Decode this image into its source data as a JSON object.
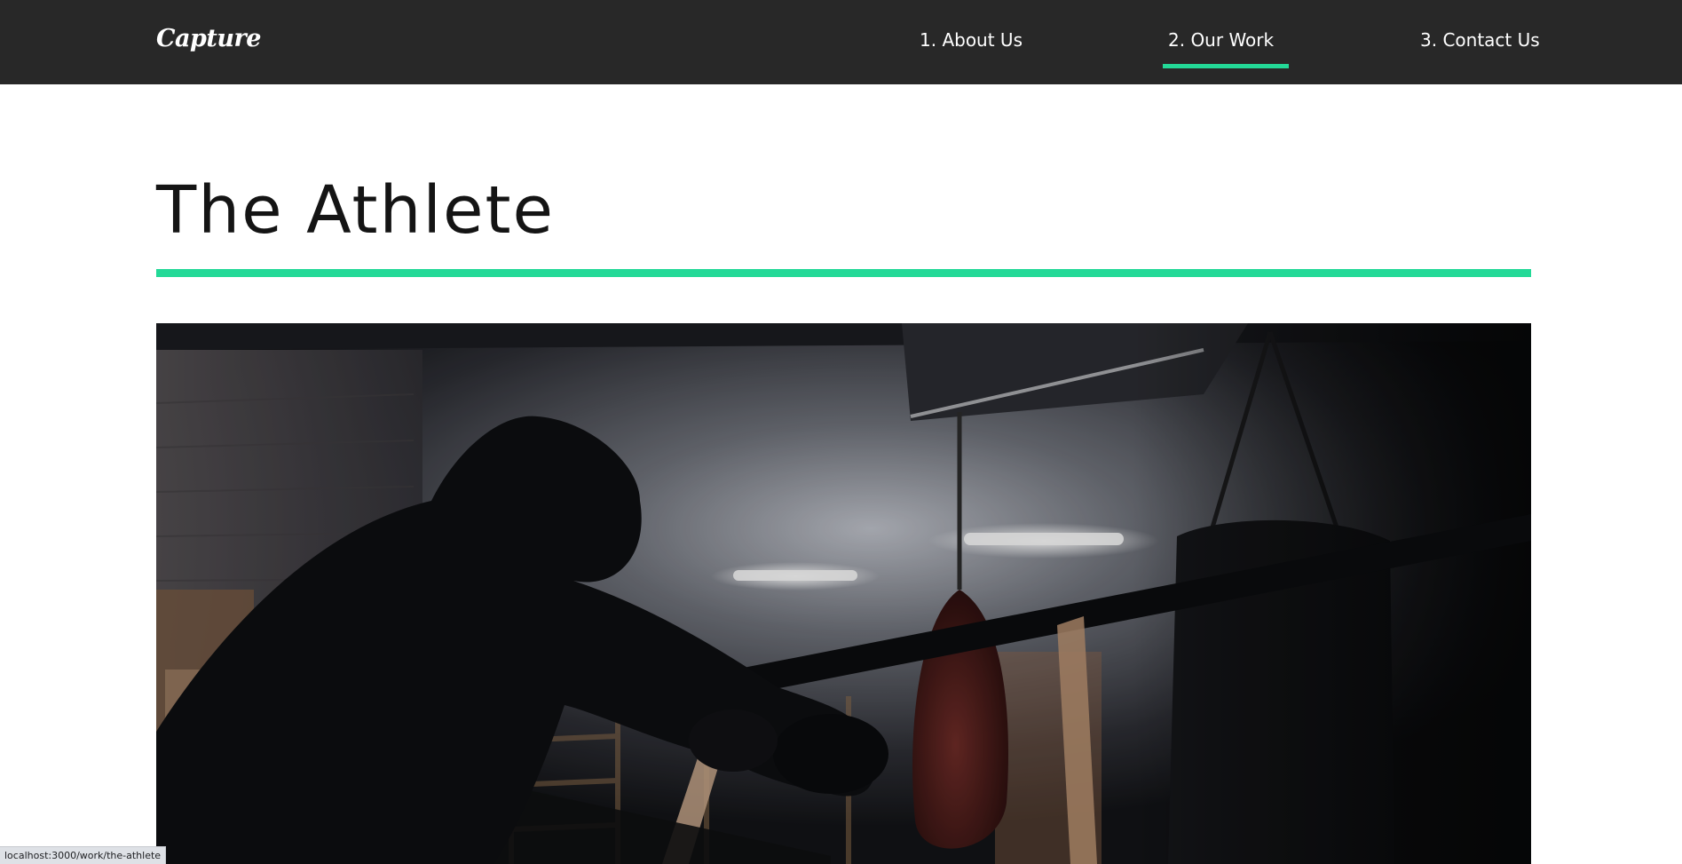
{
  "nav": {
    "logo": "Capture",
    "links": [
      {
        "label": "1. About Us"
      },
      {
        "label": "2. Our Work",
        "active": true
      },
      {
        "label": "3. Contact Us"
      }
    ]
  },
  "page": {
    "title": "The Athlete"
  },
  "hero": {
    "image_subject": "boxer leaning on boxing ring ropes in a dim gym with punching bags"
  },
  "status_bar": {
    "url": "localhost:3000/work/the-athlete"
  },
  "colors": {
    "nav_background": "#282828",
    "accent": "#23d997",
    "page_background": "#ffffff",
    "text": "#141414"
  }
}
